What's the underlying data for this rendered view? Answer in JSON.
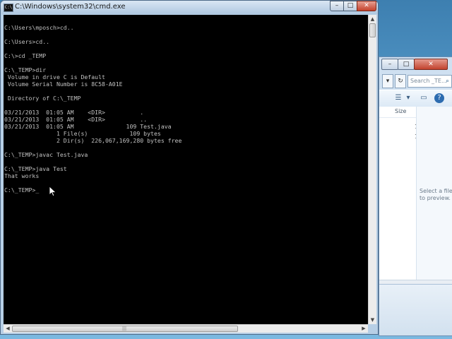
{
  "cmd_window": {
    "title": "C:\\Windows\\system32\\cmd.exe",
    "icon_label": "C:\\",
    "buttons": {
      "minimize": "–",
      "maximize": "□",
      "close": "✕"
    },
    "console_lines": [
      "",
      "C:\\Users\\mposch>cd..",
      "",
      "C:\\Users>cd..",
      "",
      "C:\\>cd _TEMP",
      "",
      "C:\\_TEMP>dir",
      " Volume in drive C is Default",
      " Volume Serial Number is 8C58-A01E",
      "",
      " Directory of C:\\_TEMP",
      "",
      "03/21/2013  01:05 AM    <DIR>          .",
      "03/21/2013  01:05 AM    <DIR>          ..",
      "03/21/2013  01:05 AM               109 Test.java",
      "               1 File(s)            109 bytes",
      "               2 Dir(s)  226,067,169,280 bytes free",
      "",
      "C:\\_TEMP>javac Test.java",
      "",
      "C:\\_TEMP>java Test",
      "That works",
      "",
      "C:\\_TEMP>_"
    ]
  },
  "explorer_window": {
    "search_placeholder": "Search _TE...",
    "column_header": "Size",
    "size_values": [
      "1",
      "1"
    ],
    "preview_text": "Select a file to preview."
  }
}
